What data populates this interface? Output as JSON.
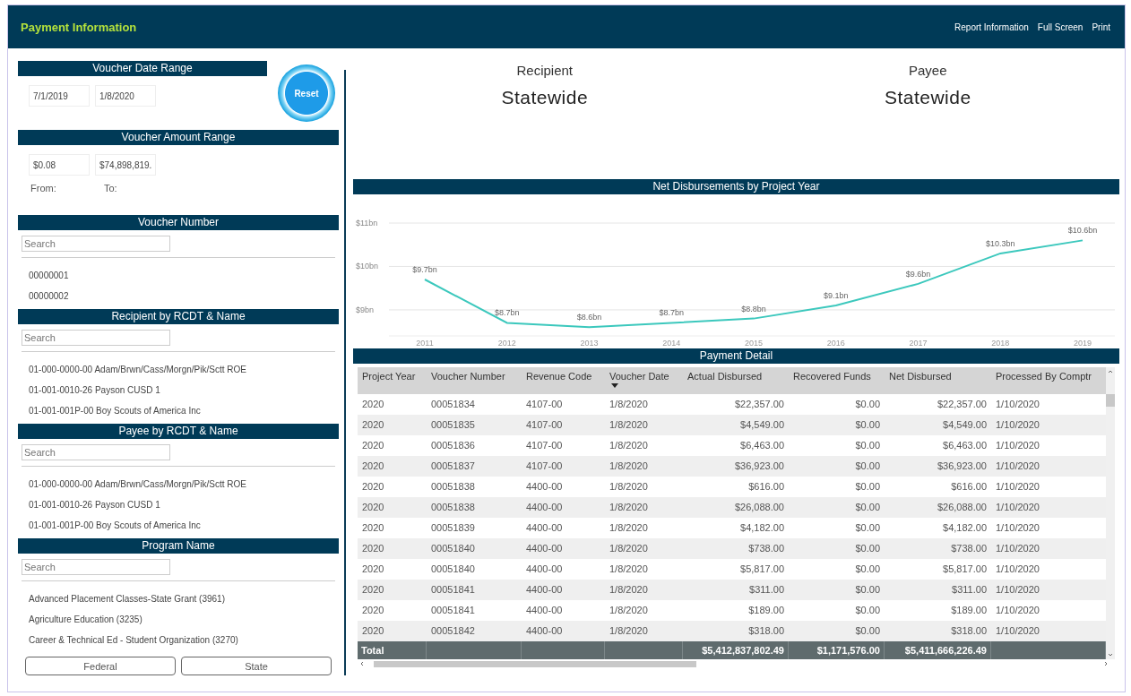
{
  "header": {
    "title": "Payment Information",
    "links": [
      "Report Information",
      "Full Screen",
      "Print"
    ]
  },
  "filters": {
    "date_range": {
      "title": "Voucher Date Range",
      "from": "7/1/2019",
      "to": "1/8/2020"
    },
    "reset_button": {
      "label": "Reset"
    },
    "amount_range": {
      "title": "Voucher Amount Range",
      "from": "$0.08",
      "to": "$74,898,819.",
      "from_label": "From:",
      "to_label": "To:"
    },
    "slicers": [
      {
        "title": "Voucher Number",
        "placeholder": "Search",
        "items": [
          "00000001",
          "00000002"
        ]
      },
      {
        "title": "Recipient by RCDT & Name",
        "placeholder": "Search",
        "items": [
          "01-000-0000-00 Adam/Brwn/Cass/Morgn/Pik/Sctt ROE",
          "01-001-0010-26 Payson CUSD 1",
          "01-001-001P-00 Boy Scouts of America Inc"
        ]
      },
      {
        "title": "Payee by RCDT & Name",
        "placeholder": "Search",
        "items": [
          "01-000-0000-00 Adam/Brwn/Cass/Morgn/Pik/Sctt ROE",
          "01-001-0010-26 Payson CUSD 1",
          "01-001-001P-00 Boy Scouts of America Inc"
        ]
      },
      {
        "title": "Program Name",
        "placeholder": "Search",
        "items": [
          "Advanced Placement Classes-State Grant (3961)",
          "Agriculture Education (3235)",
          "Career & Technical Ed - Student Organization (3270)"
        ]
      }
    ],
    "buttons": [
      "Federal",
      "State"
    ]
  },
  "summary": [
    {
      "label": "Recipient",
      "value": "Statewide"
    },
    {
      "label": "Payee",
      "value": "Statewide"
    }
  ],
  "chart": {
    "title": "Net Disbursements by Project Year",
    "chart_data": {
      "type": "line",
      "categories": [
        "2011",
        "2012",
        "2013",
        "2014",
        "2015",
        "2016",
        "2017",
        "2018",
        "2019"
      ],
      "series": [
        {
          "color": "#3cc8bd",
          "values": [
            9.7,
            8.7,
            8.6,
            8.7,
            8.8,
            9.1,
            9.6,
            10.3,
            10.6
          ]
        }
      ],
      "grid": true,
      "ylim": [
        8.4,
        11
      ],
      "yticks": [
        {
          "value": 9,
          "label": "$9bn"
        },
        {
          "value": 10,
          "label": "$10bn"
        },
        {
          "value": 11,
          "label": "$11bn"
        }
      ],
      "value_labels": [
        "$9.7bn",
        "$8.7bn",
        "$8.6bn",
        "$8.7bn",
        "$8.8bn",
        "$9.1bn",
        "$9.6bn",
        "$10.3bn",
        "$10.6bn"
      ]
    }
  },
  "table": {
    "title": "Payment  Detail",
    "columns": [
      {
        "label": "Project Year",
        "numeric": false,
        "sorted": false
      },
      {
        "label": "Voucher Number",
        "numeric": false,
        "sorted": false
      },
      {
        "label": "Revenue Code",
        "numeric": false,
        "sorted": false
      },
      {
        "label": "Voucher Date",
        "numeric": false,
        "sorted": true
      },
      {
        "label": "Actual Disbursed",
        "numeric": true,
        "sorted": false
      },
      {
        "label": "Recovered Funds",
        "numeric": true,
        "sorted": false
      },
      {
        "label": "Net Disbursed",
        "numeric": true,
        "sorted": false
      },
      {
        "label": "Processed By Comptr",
        "numeric": false,
        "sorted": false
      }
    ],
    "rows": [
      [
        "2020",
        "00051834",
        "4107-00",
        "1/8/2020",
        "$22,357.00",
        "$0.00",
        "$22,357.00",
        "1/10/2020"
      ],
      [
        "2020",
        "00051835",
        "4107-00",
        "1/8/2020",
        "$4,549.00",
        "$0.00",
        "$4,549.00",
        "1/10/2020"
      ],
      [
        "2020",
        "00051836",
        "4107-00",
        "1/8/2020",
        "$6,463.00",
        "$0.00",
        "$6,463.00",
        "1/10/2020"
      ],
      [
        "2020",
        "00051837",
        "4107-00",
        "1/8/2020",
        "$36,923.00",
        "$0.00",
        "$36,923.00",
        "1/10/2020"
      ],
      [
        "2020",
        "00051838",
        "4400-00",
        "1/8/2020",
        "$616.00",
        "$0.00",
        "$616.00",
        "1/10/2020"
      ],
      [
        "2020",
        "00051838",
        "4400-00",
        "1/8/2020",
        "$26,088.00",
        "$0.00",
        "$26,088.00",
        "1/10/2020"
      ],
      [
        "2020",
        "00051839",
        "4400-00",
        "1/8/2020",
        "$4,182.00",
        "$0.00",
        "$4,182.00",
        "1/10/2020"
      ],
      [
        "2020",
        "00051840",
        "4400-00",
        "1/8/2020",
        "$738.00",
        "$0.00",
        "$738.00",
        "1/10/2020"
      ],
      [
        "2020",
        "00051840",
        "4400-00",
        "1/8/2020",
        "$5,817.00",
        "$0.00",
        "$5,817.00",
        "1/10/2020"
      ],
      [
        "2020",
        "00051841",
        "4400-00",
        "1/8/2020",
        "$311.00",
        "$0.00",
        "$311.00",
        "1/10/2020"
      ],
      [
        "2020",
        "00051841",
        "4400-00",
        "1/8/2020",
        "$189.00",
        "$0.00",
        "$189.00",
        "1/10/2020"
      ],
      [
        "2020",
        "00051842",
        "4400-00",
        "1/8/2020",
        "$318.00",
        "$0.00",
        "$318.00",
        "1/10/2020"
      ]
    ],
    "total": {
      "label": "Total",
      "actual_disbursed": "$5,412,837,802.49",
      "recovered_funds": "$1,171,576.00",
      "net_disbursed": "$5,411,666,226.49"
    }
  }
}
